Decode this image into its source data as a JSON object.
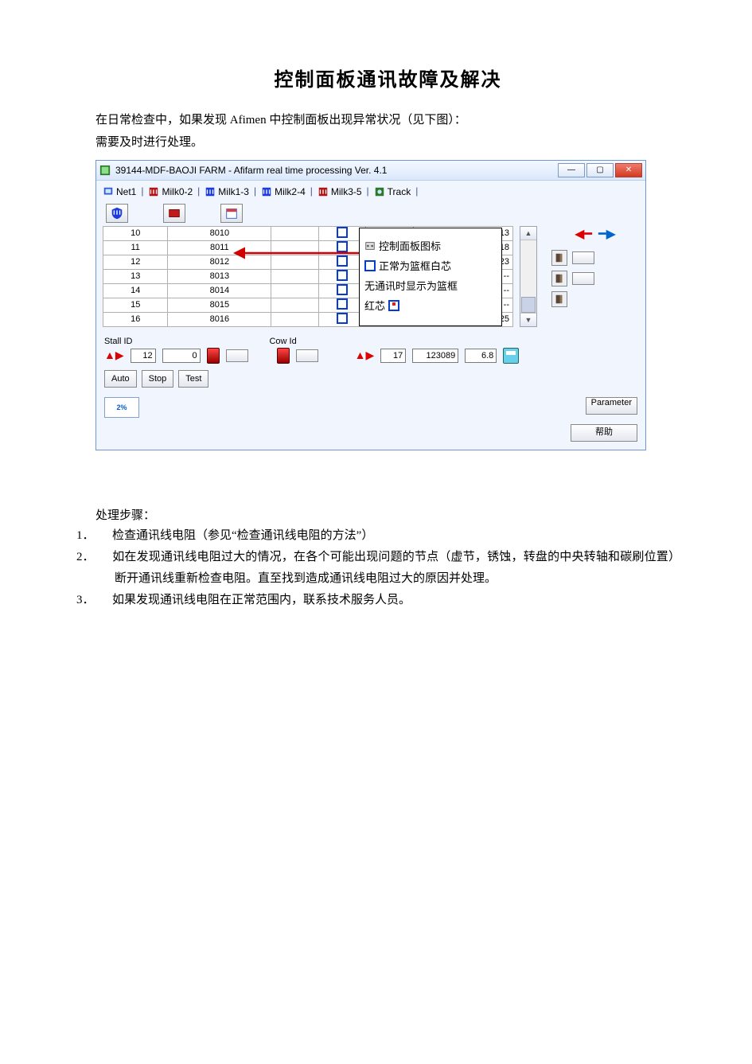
{
  "title": "控制面板通讯故障及解决",
  "intro": {
    "line1": "在日常检查中，如果发现 Afimen 中控制面板出现异常状况（见下图）：",
    "line2": "需要及时进行处理。"
  },
  "window": {
    "title": "39144-MDF-BAOJI FARM - Afifarm real time processing Ver. 4.1",
    "tabs": [
      "Net1",
      "Milk0-2",
      "Milk1-3",
      "Milk2-4",
      "Milk3-5",
      "Track"
    ],
    "toolbar_icons": [
      "shield-icon",
      "red-cube-icon",
      "calendar-icon",
      "panel-icon"
    ],
    "table": {
      "rows": [
        {
          "idx": "10",
          "stall": "8010",
          "cow": "1213"
        },
        {
          "idx": "11",
          "stall": "8011",
          "cow": "1218"
        },
        {
          "idx": "12",
          "stall": "8012",
          "cow": "1223"
        },
        {
          "idx": "13",
          "stall": "8013",
          "cow": "--"
        },
        {
          "idx": "14",
          "stall": "8014",
          "cow": "--"
        },
        {
          "idx": "15",
          "stall": "8015",
          "cow": "--"
        },
        {
          "idx": "16",
          "stall": "8016",
          "cow": "1225"
        }
      ]
    },
    "callout": {
      "line1": "控制面板图标",
      "line2": "正常为篮框白芯",
      "line3": "无通讯时显示为篮框",
      "line4_prefix": "红芯"
    },
    "status": {
      "stall_label": "Stall ID",
      "cow_label": "Cow Id",
      "left_idx": "12",
      "left_val": "0",
      "right_idx": "17",
      "right_cow": "123089",
      "right_qty": "6.8"
    },
    "control_buttons": [
      "Auto",
      "Stop",
      "Test"
    ],
    "param_button": "Parameter",
    "help_button": "帮助"
  },
  "steps_heading": "处理步骤：",
  "steps": [
    {
      "num": "1．",
      "text": "检查通讯线电阻（参见“检查通讯线电阻的方法”）"
    },
    {
      "num": "2．",
      "text": "如在发现通讯线电阻过大的情况，在各个可能出现问题的节点（虚节，锈蚀，转盘的中央转轴和碳刷位置）断开通讯线重新检查电阻。直至找到造成通讯线电阻过大的原因并处理。"
    },
    {
      "num": "3．",
      "text": "如果发现通讯线电阻在正常范围内，联系技术服务人员。"
    }
  ]
}
